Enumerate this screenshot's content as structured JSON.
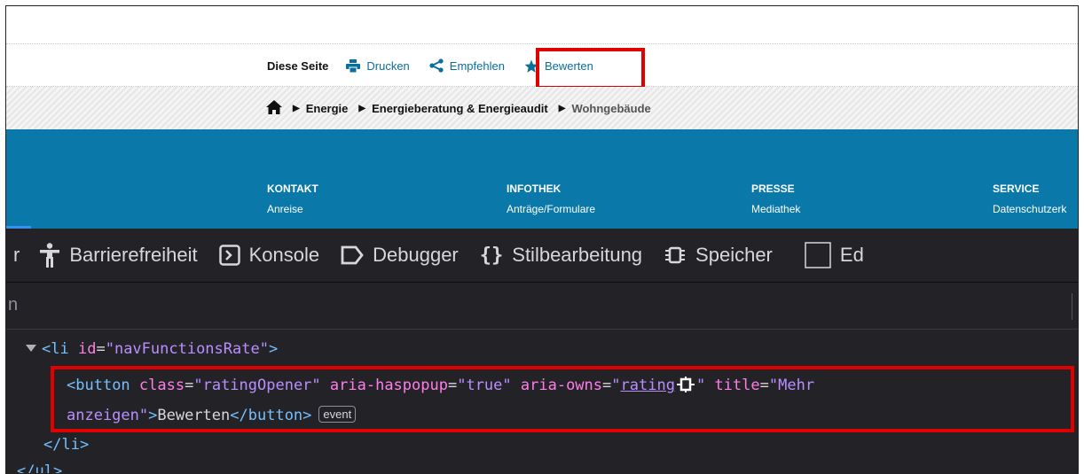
{
  "site": {
    "functions": {
      "label": "Diese Seite",
      "items": [
        {
          "label": "Drucken",
          "icon": "print-icon"
        },
        {
          "label": "Empfehlen",
          "icon": "share-icon"
        },
        {
          "label": "Bewerten",
          "icon": "star-icon"
        }
      ]
    },
    "breadcrumb": {
      "home_icon": "home-icon",
      "items": [
        "Energie",
        "Energieberatung & Energieaudit"
      ],
      "current": "Wohngebäude"
    },
    "nav": [
      {
        "head": "KONTAKT",
        "sub": "Anreise"
      },
      {
        "head": "INFOTHEK",
        "sub": "Anträge/Formulare"
      },
      {
        "head": "PRESSE",
        "sub": "Mediathek"
      },
      {
        "head": "SERVICE",
        "sub": "Datenschutzerk"
      }
    ],
    "colors": {
      "link": "#0a6f9c",
      "nav_bg": "#0a78a8",
      "highlight": "#e00000"
    }
  },
  "devtools": {
    "tabs": [
      {
        "label": "r",
        "icon": ""
      },
      {
        "label": "Barrierefreiheit",
        "icon": "accessibility-icon"
      },
      {
        "label": "Konsole",
        "icon": "console-icon"
      },
      {
        "label": "Debugger",
        "icon": "debugger-icon"
      },
      {
        "label": "Stilbearbeitung",
        "icon": "style-editor-icon"
      },
      {
        "label": "Speicher",
        "icon": "memory-icon"
      },
      {
        "label": "Ed",
        "icon": "checkbox-icon"
      }
    ],
    "search_text": "n",
    "tree": {
      "li_open_tag": "li",
      "li_attr": "id",
      "li_val": "\"navFunctionsRate\"",
      "button_tag": "button",
      "attr_class": "class",
      "val_class": "\"ratingOpener\"",
      "attr_haspopup": "aria-haspopup",
      "val_haspopup": "\"true\"",
      "attr_owns": "aria-owns",
      "val_owns_link": "rating",
      "attr_title": "title",
      "val_title_start": "\"Mehr",
      "val_title_end": "anzeigen\"",
      "button_text": "Bewerten",
      "event_badge": "event",
      "li_close": "li",
      "ul_close": "ul"
    }
  }
}
